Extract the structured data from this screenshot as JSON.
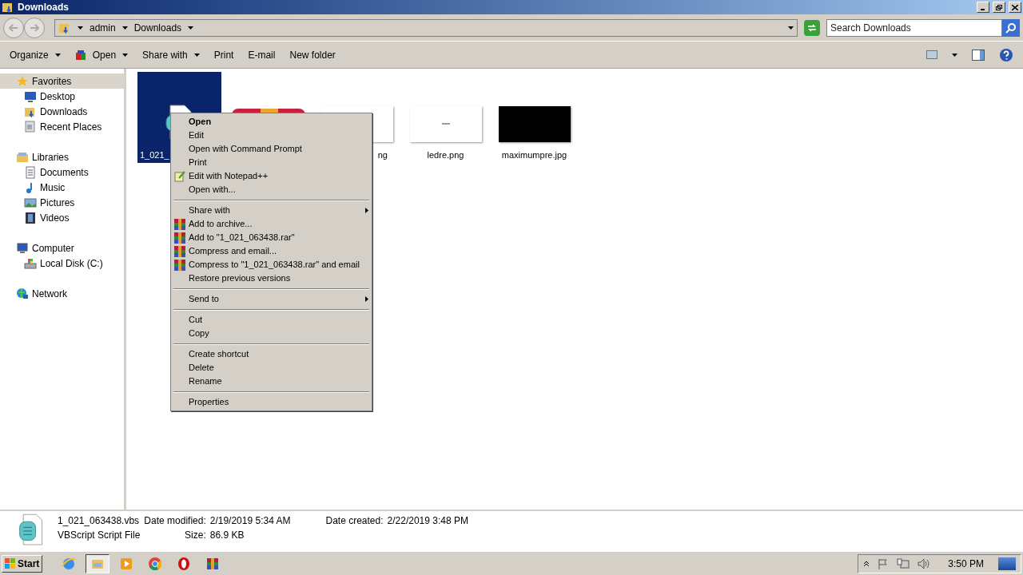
{
  "window": {
    "title": "Downloads"
  },
  "address": {
    "crumbs": [
      "admin",
      "Downloads"
    ]
  },
  "search": {
    "placeholder": "Search Downloads"
  },
  "toolbar": [
    {
      "label": "Organize",
      "kind": "dropdown"
    },
    {
      "label": "Open",
      "kind": "open"
    },
    {
      "label": "Share with",
      "kind": "dropdown"
    },
    {
      "label": "Print",
      "kind": "plain"
    },
    {
      "label": "E-mail",
      "kind": "plain"
    },
    {
      "label": "New folder",
      "kind": "plain"
    }
  ],
  "sidebar": {
    "items": [
      {
        "label": "Favorites",
        "kind": "star",
        "selected": true,
        "children": [
          {
            "label": "Desktop",
            "kind": "desktop",
            "selected": false
          },
          {
            "label": "Downloads",
            "kind": "folder",
            "selected": false
          },
          {
            "label": "Recent Places",
            "kind": "recent",
            "selected": false
          }
        ]
      },
      {
        "label": "Libraries",
        "kind": "library",
        "selected": false,
        "children": [
          {
            "label": "Documents",
            "kind": "doc",
            "selected": false
          },
          {
            "label": "Music",
            "kind": "music",
            "selected": false
          },
          {
            "label": "Pictures",
            "kind": "pictures",
            "selected": false
          },
          {
            "label": "Videos",
            "kind": "video",
            "selected": false
          }
        ]
      },
      {
        "label": "Computer",
        "kind": "computer",
        "selected": false,
        "children": [
          {
            "label": "Local Disk (C:)",
            "kind": "disk",
            "selected": false
          }
        ]
      },
      {
        "label": "Network",
        "kind": "network",
        "selected": false
      }
    ]
  },
  "files": [
    {
      "name": "1_021_",
      "kind": "script",
      "selected": true
    },
    {
      "kind": "archive",
      "selected": false
    },
    {
      "name": "ng",
      "kind": "white",
      "selected": false
    },
    {
      "name": "ledre.png",
      "kind": "white",
      "selected": false
    },
    {
      "name": "maximumpre.jpg",
      "kind": "black",
      "selected": false
    }
  ],
  "context_menu": [
    {
      "kind": "default",
      "label": "Open"
    },
    {
      "kind": "item",
      "label": "Edit"
    },
    {
      "kind": "item",
      "label": "Open with Command Prompt"
    },
    {
      "kind": "item",
      "label": "Print"
    },
    {
      "kind": "notepad",
      "label": "Edit with Notepad++"
    },
    {
      "kind": "item",
      "label": "Open with..."
    },
    {
      "kind": "separator"
    },
    {
      "kind": "submenu",
      "label": "Share with"
    },
    {
      "kind": "archiver",
      "label": "Add to archive..."
    },
    {
      "kind": "archiver",
      "label": "Add to \"1_021_063438.rar\""
    },
    {
      "kind": "archiver",
      "label": "Compress and email..."
    },
    {
      "kind": "archiver",
      "label": "Compress to \"1_021_063438.rar\" and email"
    },
    {
      "kind": "item",
      "label": "Restore previous versions"
    },
    {
      "kind": "separator"
    },
    {
      "kind": "submenu",
      "label": "Send to"
    },
    {
      "kind": "separator"
    },
    {
      "kind": "item",
      "label": "Cut"
    },
    {
      "kind": "item",
      "label": "Copy"
    },
    {
      "kind": "separator"
    },
    {
      "kind": "item",
      "label": "Create shortcut"
    },
    {
      "kind": "item",
      "label": "Delete"
    },
    {
      "kind": "item",
      "label": "Rename"
    },
    {
      "kind": "separator"
    },
    {
      "kind": "item",
      "label": "Properties"
    }
  ],
  "details": {
    "name": "1_021_063438.vbs",
    "type": "VBScript Script File",
    "fields": [
      {
        "label": "Date modified:",
        "value": "2/19/2019 5:34 AM"
      },
      {
        "label": "Size:",
        "value": "86.9 KB"
      },
      {
        "label": "Date created:",
        "value": "2/22/2019 3:48 PM"
      }
    ]
  },
  "taskbar": {
    "start": "Start",
    "apps": [
      {
        "kind": "ie",
        "active": false
      },
      {
        "kind": "explorer",
        "active": true
      },
      {
        "kind": "media",
        "active": false
      },
      {
        "kind": "chrome",
        "active": false
      },
      {
        "kind": "opera",
        "active": false
      },
      {
        "kind": "winrar",
        "active": false
      }
    ],
    "clock": "3:50 PM"
  }
}
